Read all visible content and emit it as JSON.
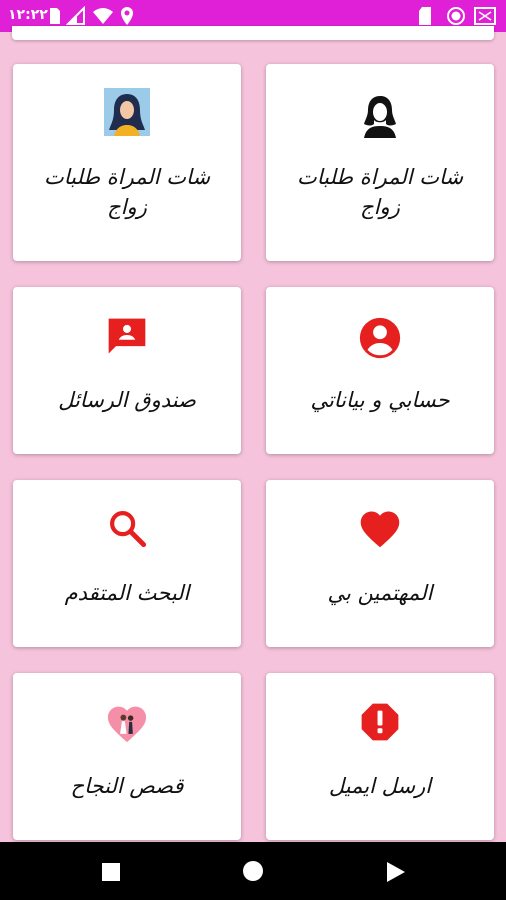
{
  "status_bar": {
    "time": "١٢:٢٢",
    "icons": [
      "storage-icon",
      "signal-icon",
      "wifi-icon",
      "location-icon",
      "sd-card-icon",
      "circle-icon",
      "battery-icon"
    ],
    "color": "#e020d6"
  },
  "cards": [
    {
      "label": "شات المراة طلبات زواج",
      "icon": "woman-silhouette-icon"
    },
    {
      "label": "شات المراة طلبات زواج",
      "icon": "woman-portrait-icon"
    },
    {
      "label": "حسابي و بياناتي",
      "icon": "account-circle-icon"
    },
    {
      "label": "صندوق الرسائل",
      "icon": "message-person-icon"
    },
    {
      "label": "المهتمين بي",
      "icon": "heart-icon"
    },
    {
      "label": "البحث المتقدم",
      "icon": "search-icon"
    },
    {
      "label": "ارسل ايميل",
      "icon": "alert-octagon-icon"
    },
    {
      "label": "قصص النجاح",
      "icon": "couple-heart-icon"
    }
  ],
  "colors": {
    "accent": "#e61f1f",
    "background": "#f6c3dc"
  },
  "nav_bar": {
    "buttons": [
      "recents-button",
      "home-button",
      "back-button"
    ]
  }
}
